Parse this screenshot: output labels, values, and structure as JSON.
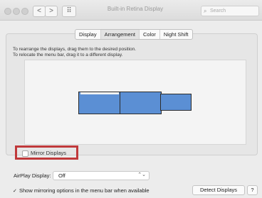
{
  "window": {
    "title": "Built-in Retina Display"
  },
  "toolbar": {
    "back_glyph": "<",
    "forward_glyph": ">",
    "grid_glyph": "⠿",
    "search_placeholder": "Search"
  },
  "tabs": [
    {
      "label": "Display"
    },
    {
      "label": "Arrangement"
    },
    {
      "label": "Color"
    },
    {
      "label": "Night Shift"
    }
  ],
  "active_tab": "Arrangement",
  "instructions": {
    "line1": "To rearrange the displays, drag them to the desired position.",
    "line2": "To relocate the menu bar, drag it to a different display."
  },
  "displays": {
    "count": 3,
    "color": "#5b8fd4"
  },
  "mirror": {
    "label": "Mirror Displays",
    "checked": false,
    "highlight_color": "#c0393b"
  },
  "airplay": {
    "label": "AirPlay Display:",
    "value": "Off"
  },
  "footer": {
    "show_mirroring_label": "Show mirroring options in the menu bar when available",
    "show_mirroring_checked": true,
    "detect_label": "Detect Displays",
    "help_label": "?"
  }
}
